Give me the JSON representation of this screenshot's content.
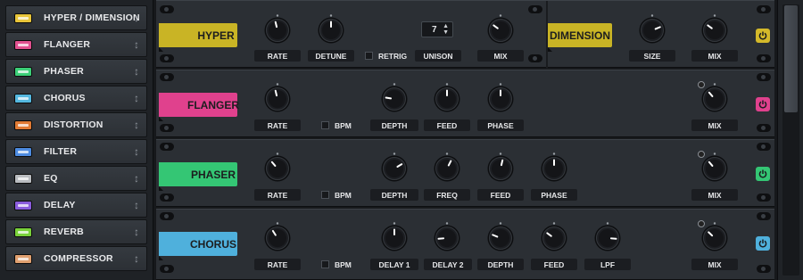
{
  "sidebar": {
    "items": [
      {
        "label": "HYPER / DIMENSION",
        "color": "#e8c53a"
      },
      {
        "label": "FLANGER",
        "color": "#e0508f"
      },
      {
        "label": "PHASER",
        "color": "#3ccf78"
      },
      {
        "label": "CHORUS",
        "color": "#55b8e0"
      },
      {
        "label": "DISTORTION",
        "color": "#e07a34"
      },
      {
        "label": "FILTER",
        "color": "#4d8be0"
      },
      {
        "label": "EQ",
        "color": "#b9bcc0"
      },
      {
        "label": "DELAY",
        "color": "#8a5cdc"
      },
      {
        "label": "REVERB",
        "color": "#79d13a"
      },
      {
        "label": "COMPRESSOR",
        "color": "#e0a070"
      }
    ],
    "drag_glyph": "↕"
  },
  "hyper": {
    "title": "HYPER",
    "color": "#c9b425",
    "rate": "RATE",
    "detune": "DETUNE",
    "retrig": "RETRIG",
    "unison": "UNISON",
    "unison_value": "7",
    "mix": "MIX"
  },
  "dimension": {
    "title": "DIMENSION",
    "color": "#c9b425",
    "size": "SIZE",
    "mix": "MIX",
    "power_color": "#d4b92a"
  },
  "flanger": {
    "title": "FLANGER",
    "color": "#e0418d",
    "rate": "RATE",
    "bpm": "BPM",
    "depth": "DEPTH",
    "feed": "FEED",
    "phase": "PHASE",
    "mix": "MIX",
    "power_color": "#e0418d"
  },
  "phaser": {
    "title": "PHASER",
    "color": "#34c674",
    "rate": "RATE",
    "bpm": "BPM",
    "depth": "DEPTH",
    "freq": "FREQ",
    "feed": "FEED",
    "phase": "PHASE",
    "mix": "MIX",
    "power_color": "#34c674"
  },
  "chorus": {
    "title": "CHORUS",
    "color": "#4fb0dc",
    "rate": "RATE",
    "bpm": "BPM",
    "delay1": "DELAY 1",
    "delay2": "DELAY 2",
    "depth": "DEPTH",
    "feed": "FEED",
    "lpf": "LPF",
    "mix": "MIX",
    "power_color": "#4fb0dc"
  },
  "knob_values": {
    "hyper_rate": 0.45,
    "hyper_detune": 0.5,
    "hyper_mix": 0.3,
    "dimension_size": 0.75,
    "dimension_mix": 0.3,
    "flanger_rate": 0.45,
    "flanger_depth": 0.2,
    "flanger_feed": 0.5,
    "flanger_phase": 0.5,
    "flanger_mix": 0.35,
    "phaser_rate": 0.35,
    "phaser_depth": 0.72,
    "phaser_freq": 0.6,
    "phaser_feed": 0.55,
    "phaser_phase": 0.5,
    "phaser_mix": 0.35,
    "chorus_rate": 0.38,
    "chorus_delay1": 0.5,
    "chorus_delay2": 0.15,
    "chorus_depth": 0.25,
    "chorus_feed": 0.3,
    "chorus_lpf": 0.85,
    "chorus_mix": 0.33
  }
}
